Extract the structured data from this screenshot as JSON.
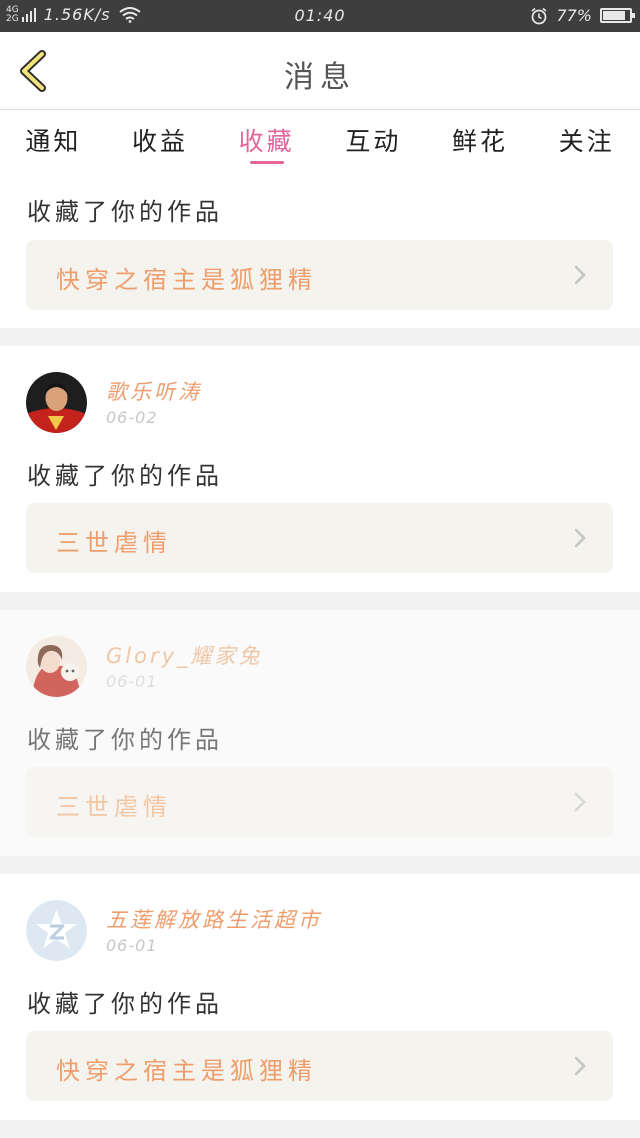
{
  "status_bar": {
    "network_top": "4G",
    "network_bottom": "2G",
    "speed": "1.56K/s",
    "time": "01:40",
    "battery": "77%",
    "battery_level": 0.77
  },
  "header": {
    "title": "消息"
  },
  "tabs": [
    {
      "label": "通知",
      "active": false
    },
    {
      "label": "收益",
      "active": false
    },
    {
      "label": "收藏",
      "active": true
    },
    {
      "label": "互动",
      "active": false
    },
    {
      "label": "鲜花",
      "active": false
    },
    {
      "label": "关注",
      "active": false
    }
  ],
  "items": [
    {
      "message": "收藏了你的作品",
      "work_title": "快穿之宿主是狐狸精"
    },
    {
      "user": "歌乐听涛",
      "date": "06-02",
      "message": "收藏了你的作品",
      "work_title": "三世虐情"
    },
    {
      "user": "Glory_耀家兔",
      "date": "06-01",
      "message": "收藏了你的作品",
      "work_title": "三世虐情"
    },
    {
      "user": "五莲解放路生活超市",
      "date": "06-01",
      "message": "收藏了你的作品",
      "work_title": "快穿之宿主是狐狸精"
    }
  ],
  "colors": {
    "accent": "#e4649b",
    "name": "#ee9d6c",
    "box": "#f4f3ed"
  }
}
